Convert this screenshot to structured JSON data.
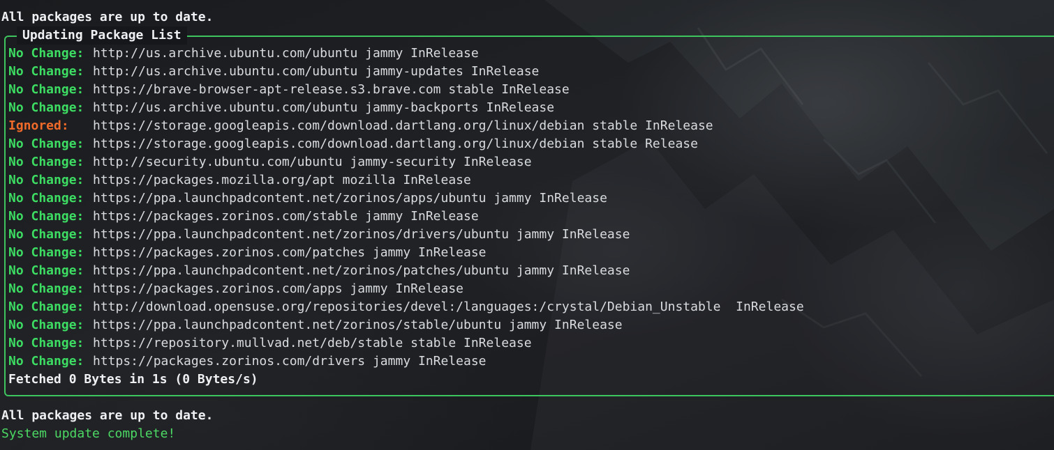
{
  "header_message": "All packages are up to date.",
  "panel": {
    "title": "Updating Package List",
    "border_color": "#3fc55d",
    "entries": [
      {
        "status": "No Change:",
        "kind": "ok",
        "url": "http://us.archive.ubuntu.com/ubuntu jammy InRelease"
      },
      {
        "status": "No Change:",
        "kind": "ok",
        "url": "http://us.archive.ubuntu.com/ubuntu jammy-updates InRelease"
      },
      {
        "status": "No Change:",
        "kind": "ok",
        "url": "https://brave-browser-apt-release.s3.brave.com stable InRelease"
      },
      {
        "status": "No Change:",
        "kind": "ok",
        "url": "http://us.archive.ubuntu.com/ubuntu jammy-backports InRelease"
      },
      {
        "status": "Ignored:",
        "kind": "ignored",
        "url": "https://storage.googleapis.com/download.dartlang.org/linux/debian stable InRelease"
      },
      {
        "status": "No Change:",
        "kind": "ok",
        "url": "https://storage.googleapis.com/download.dartlang.org/linux/debian stable Release"
      },
      {
        "status": "No Change:",
        "kind": "ok",
        "url": "http://security.ubuntu.com/ubuntu jammy-security InRelease"
      },
      {
        "status": "No Change:",
        "kind": "ok",
        "url": "https://packages.mozilla.org/apt mozilla InRelease"
      },
      {
        "status": "No Change:",
        "kind": "ok",
        "url": "https://ppa.launchpadcontent.net/zorinos/apps/ubuntu jammy InRelease"
      },
      {
        "status": "No Change:",
        "kind": "ok",
        "url": "https://packages.zorinos.com/stable jammy InRelease"
      },
      {
        "status": "No Change:",
        "kind": "ok",
        "url": "https://ppa.launchpadcontent.net/zorinos/drivers/ubuntu jammy InRelease"
      },
      {
        "status": "No Change:",
        "kind": "ok",
        "url": "https://packages.zorinos.com/patches jammy InRelease"
      },
      {
        "status": "No Change:",
        "kind": "ok",
        "url": "https://ppa.launchpadcontent.net/zorinos/patches/ubuntu jammy InRelease"
      },
      {
        "status": "No Change:",
        "kind": "ok",
        "url": "https://packages.zorinos.com/apps jammy InRelease"
      },
      {
        "status": "No Change:",
        "kind": "ok",
        "url": "http://download.opensuse.org/repositories/devel:/languages:/crystal/Debian_Unstable  InRelease"
      },
      {
        "status": "No Change:",
        "kind": "ok",
        "url": "https://ppa.launchpadcontent.net/zorinos/stable/ubuntu jammy InRelease"
      },
      {
        "status": "No Change:",
        "kind": "ok",
        "url": "https://repository.mullvad.net/deb/stable stable InRelease"
      },
      {
        "status": "No Change:",
        "kind": "ok",
        "url": "https://packages.zorinos.com/drivers jammy InRelease"
      }
    ],
    "fetched": "Fetched 0 Bytes in 1s (0 Bytes/s)"
  },
  "footer": {
    "message": "All packages are up to date.",
    "complete": "System update complete!"
  },
  "colors": {
    "ok": "#3ddc62",
    "ignored": "#f06a2a",
    "complete": "#4cd964",
    "text": "#d9dcdf"
  }
}
